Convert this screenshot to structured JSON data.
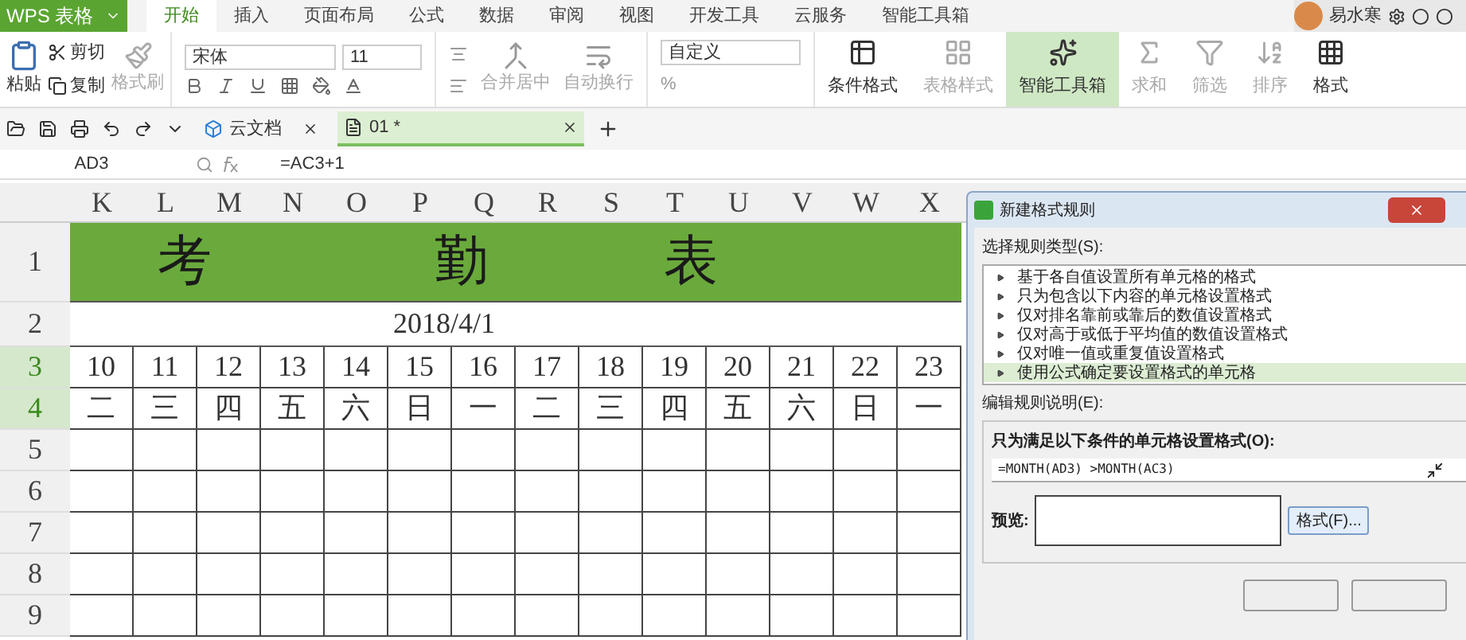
{
  "app_button": {
    "label": "WPS 表格"
  },
  "menu_tabs": [
    {
      "label": "开始",
      "selected": true
    },
    {
      "label": "插入",
      "selected": false
    },
    {
      "label": "页面布局",
      "selected": false
    },
    {
      "label": "公式",
      "selected": false
    },
    {
      "label": "数据",
      "selected": false
    },
    {
      "label": "审阅",
      "selected": false
    },
    {
      "label": "视图",
      "selected": false
    },
    {
      "label": "开发工具",
      "selected": false
    },
    {
      "label": "云服务",
      "selected": false
    },
    {
      "label": "智能工具箱",
      "selected": false
    }
  ],
  "user": {
    "name": "易水寒"
  },
  "clipboard": {
    "paste": "粘贴",
    "cut": "剪切",
    "copy": "复制",
    "painter": {
      "label": "格式刷",
      "disabled": true
    }
  },
  "font": {
    "name": "宋体",
    "size": "11"
  },
  "alignment": [
    {
      "label": "合并居中",
      "disabled": true
    },
    {
      "label": "自动换行",
      "disabled": true
    }
  ],
  "number_format": {
    "value": "自定义",
    "percent": "%"
  },
  "large_buttons": [
    {
      "label": "条件格式",
      "disabled": false,
      "highlighted": false
    },
    {
      "label": "表格样式",
      "disabled": true,
      "highlighted": false
    },
    {
      "label": "智能工具箱",
      "disabled": false,
      "highlighted": true
    },
    {
      "label": "求和",
      "disabled": true,
      "highlighted": false
    },
    {
      "label": "筛选",
      "disabled": true,
      "highlighted": false
    },
    {
      "label": "排序",
      "disabled": true,
      "highlighted": false
    },
    {
      "label": "格式",
      "disabled": false,
      "highlighted": false
    }
  ],
  "doc_tabs": [
    {
      "label": "云文档",
      "selected": false
    },
    {
      "label": "01 *",
      "selected": true
    }
  ],
  "formula_bar": {
    "name_box": "AD3",
    "formula": "=AC3+1"
  },
  "sheet": {
    "columns": [
      "K",
      "L",
      "M",
      "N",
      "O",
      "P",
      "Q",
      "R",
      "S",
      "T",
      "U",
      "V",
      "W",
      "X"
    ],
    "rows": [
      {
        "label": "1",
        "selected": false
      },
      {
        "label": "2",
        "selected": false
      },
      {
        "label": "3",
        "selected": true
      },
      {
        "label": "4",
        "selected": true
      },
      {
        "label": "5",
        "selected": false
      },
      {
        "label": "6",
        "selected": false
      },
      {
        "label": "7",
        "selected": false
      },
      {
        "label": "8",
        "selected": false
      },
      {
        "label": "9",
        "selected": false
      }
    ],
    "title_chars": [
      "考",
      "勤",
      "表"
    ],
    "date": "2018/4/1",
    "days": [
      "10",
      "11",
      "12",
      "13",
      "14",
      "15",
      "16",
      "17",
      "18",
      "19",
      "20",
      "21",
      "22",
      "23"
    ],
    "weekdays": [
      "二",
      "三",
      "四",
      "五",
      "六",
      "日",
      "一",
      "二",
      "三",
      "四",
      "五",
      "六",
      "日",
      "一"
    ]
  },
  "dialog": {
    "title": "新建格式规则",
    "rule_type_label": "选择规则类型(S):",
    "rule_types": [
      {
        "label": "基于各自值设置所有单元格的格式",
        "selected": false
      },
      {
        "label": "只为包含以下内容的单元格设置格式",
        "selected": false
      },
      {
        "label": "仅对排名靠前或靠后的数值设置格式",
        "selected": false
      },
      {
        "label": "仅对高于或低于平均值的数值设置格式",
        "selected": false
      },
      {
        "label": "仅对唯一值或重复值设置格式",
        "selected": false
      },
      {
        "label": "使用公式确定要设置格式的单元格",
        "selected": true
      }
    ],
    "description_label": "编辑规则说明(E):",
    "condition_label": "只为满足以下条件的单元格设置格式(O):",
    "formula": "=MONTH(AD3) >MONTH(AC3)",
    "preview_label": "预览:",
    "format_button": "格式(F)..."
  }
}
